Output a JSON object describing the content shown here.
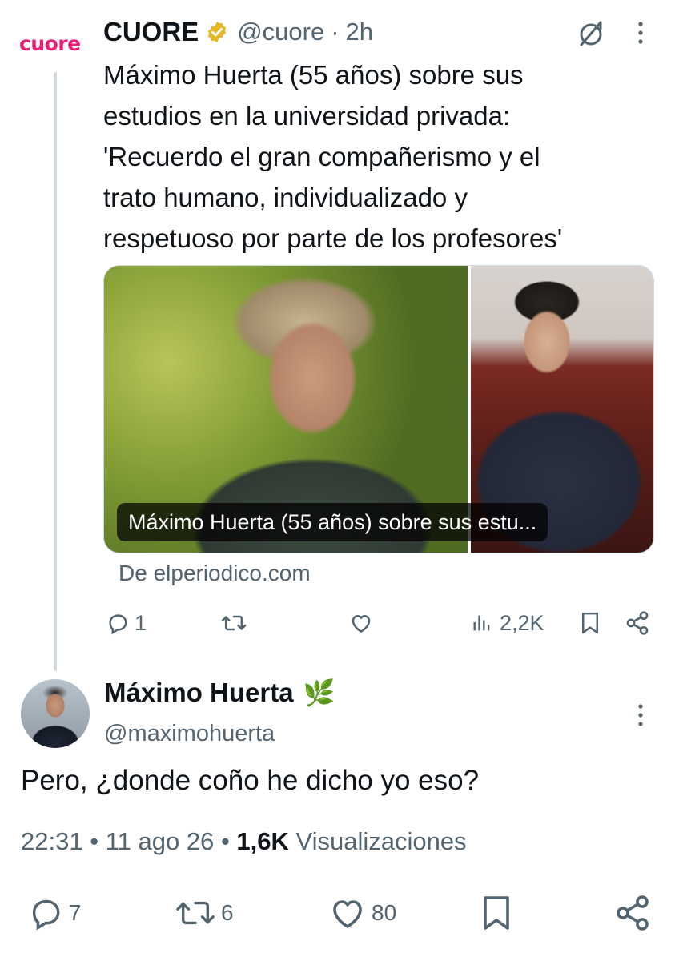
{
  "tweet": {
    "account_logo_text": "cuore",
    "author_name": "CUORE",
    "handle": "@cuore",
    "separator": "·",
    "time": "2h",
    "text_lines": [
      "Máximo Huerta (55 años) sobre sus",
      "estudios en la universidad privada:",
      "'Recuerdo el gran compañerismo y el",
      "trato humano, individualizado y",
      "respetuoso por parte de los profesores'"
    ],
    "link_card": {
      "caption": "Máximo Huerta (55 años) sobre sus estu...",
      "source": "De elperiodico.com"
    },
    "actions": {
      "replies": "1",
      "reposts": "",
      "likes": "",
      "views": "2,2K"
    }
  },
  "reply": {
    "author_name": "Máximo Huerta",
    "name_emoji": "🌿",
    "handle": "@maximohuerta",
    "text": "Pero, ¿donde coño he dicho yo eso?",
    "time": "22:31",
    "date": "11 ago 26",
    "views_count": "1,6K",
    "views_label": "Visualizaciones",
    "meta_separator": "•",
    "actions": {
      "replies": "7",
      "reposts": "6",
      "likes": "80"
    }
  },
  "colors": {
    "brand_pink": "#e5217a",
    "verified_gold": "#e8b725",
    "text_primary": "#0f1419",
    "text_secondary": "#536471",
    "thread_line": "#cfd9de"
  },
  "icons": [
    "grok-icon",
    "more-icon",
    "verified-badge-icon",
    "reply-icon",
    "repost-icon",
    "like-icon",
    "views-icon",
    "bookmark-icon",
    "share-icon",
    "leaf-emoji"
  ]
}
